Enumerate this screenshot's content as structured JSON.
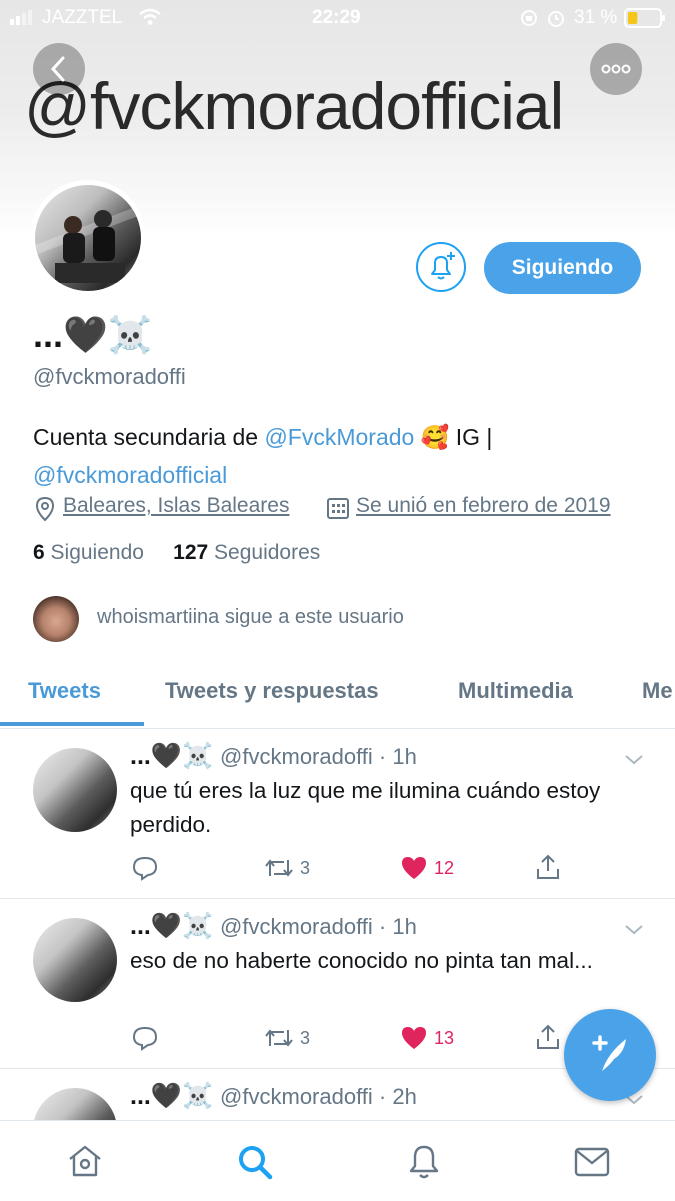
{
  "status_bar": {
    "carrier": "JAZZTEL",
    "time": "22:29",
    "battery_percent": "31 %",
    "battery_level": 0.31
  },
  "banner": {
    "text": "@fvckmoradofficial"
  },
  "profile": {
    "display_name": "...🖤☠️",
    "handle": "@fvckmoradoffi",
    "bio_prefix": "Cuenta secundaria de ",
    "bio_mention": "@FvckMorado",
    "bio_emoji": "🥰",
    "bio_suffix": " IG |",
    "bio_link": "@fvckmoradofficial",
    "location": "Baleares, Islas Baleares",
    "joined": "Se unió en febrero de 2019",
    "following_count": "6",
    "following_label": "Siguiendo",
    "followers_count": "127",
    "followers_label": "Seguidores",
    "followed_by": "whoismartiina sigue a este usuario",
    "follow_button": "Siguiendo"
  },
  "tabs": [
    {
      "label": "Tweets",
      "active": true
    },
    {
      "label": "Tweets y respuestas",
      "active": false
    },
    {
      "label": "Multimedia",
      "active": false
    },
    {
      "label": "Me",
      "active": false
    }
  ],
  "tweets": [
    {
      "name": "...🖤☠️",
      "handle": "@fvckmoradoffi · 1h",
      "text": "que tú eres la luz que me ilumina cuándo estoy perdido.",
      "retweets": "3",
      "likes": "12"
    },
    {
      "name": "...🖤☠️",
      "handle": "@fvckmoradoffi · 1h",
      "text": "eso de no haberte conocido no pinta tan mal...",
      "retweets": "3",
      "likes": "13"
    },
    {
      "name": "...🖤☠️",
      "handle": "@fvckmoradoffi · 2h",
      "text": "",
      "retweets": "",
      "likes": ""
    }
  ],
  "colors": {
    "accent": "#4aa3e8",
    "like": "#e0245e",
    "muted": "#657786"
  },
  "icons": [
    "back-icon",
    "more-icon",
    "add-notification-icon",
    "location-icon",
    "calendar-icon",
    "reply-icon",
    "retweet-icon",
    "heart-icon",
    "share-icon",
    "chevron-down-icon",
    "compose-icon",
    "home-icon",
    "search-icon",
    "notifications-icon",
    "messages-icon"
  ]
}
